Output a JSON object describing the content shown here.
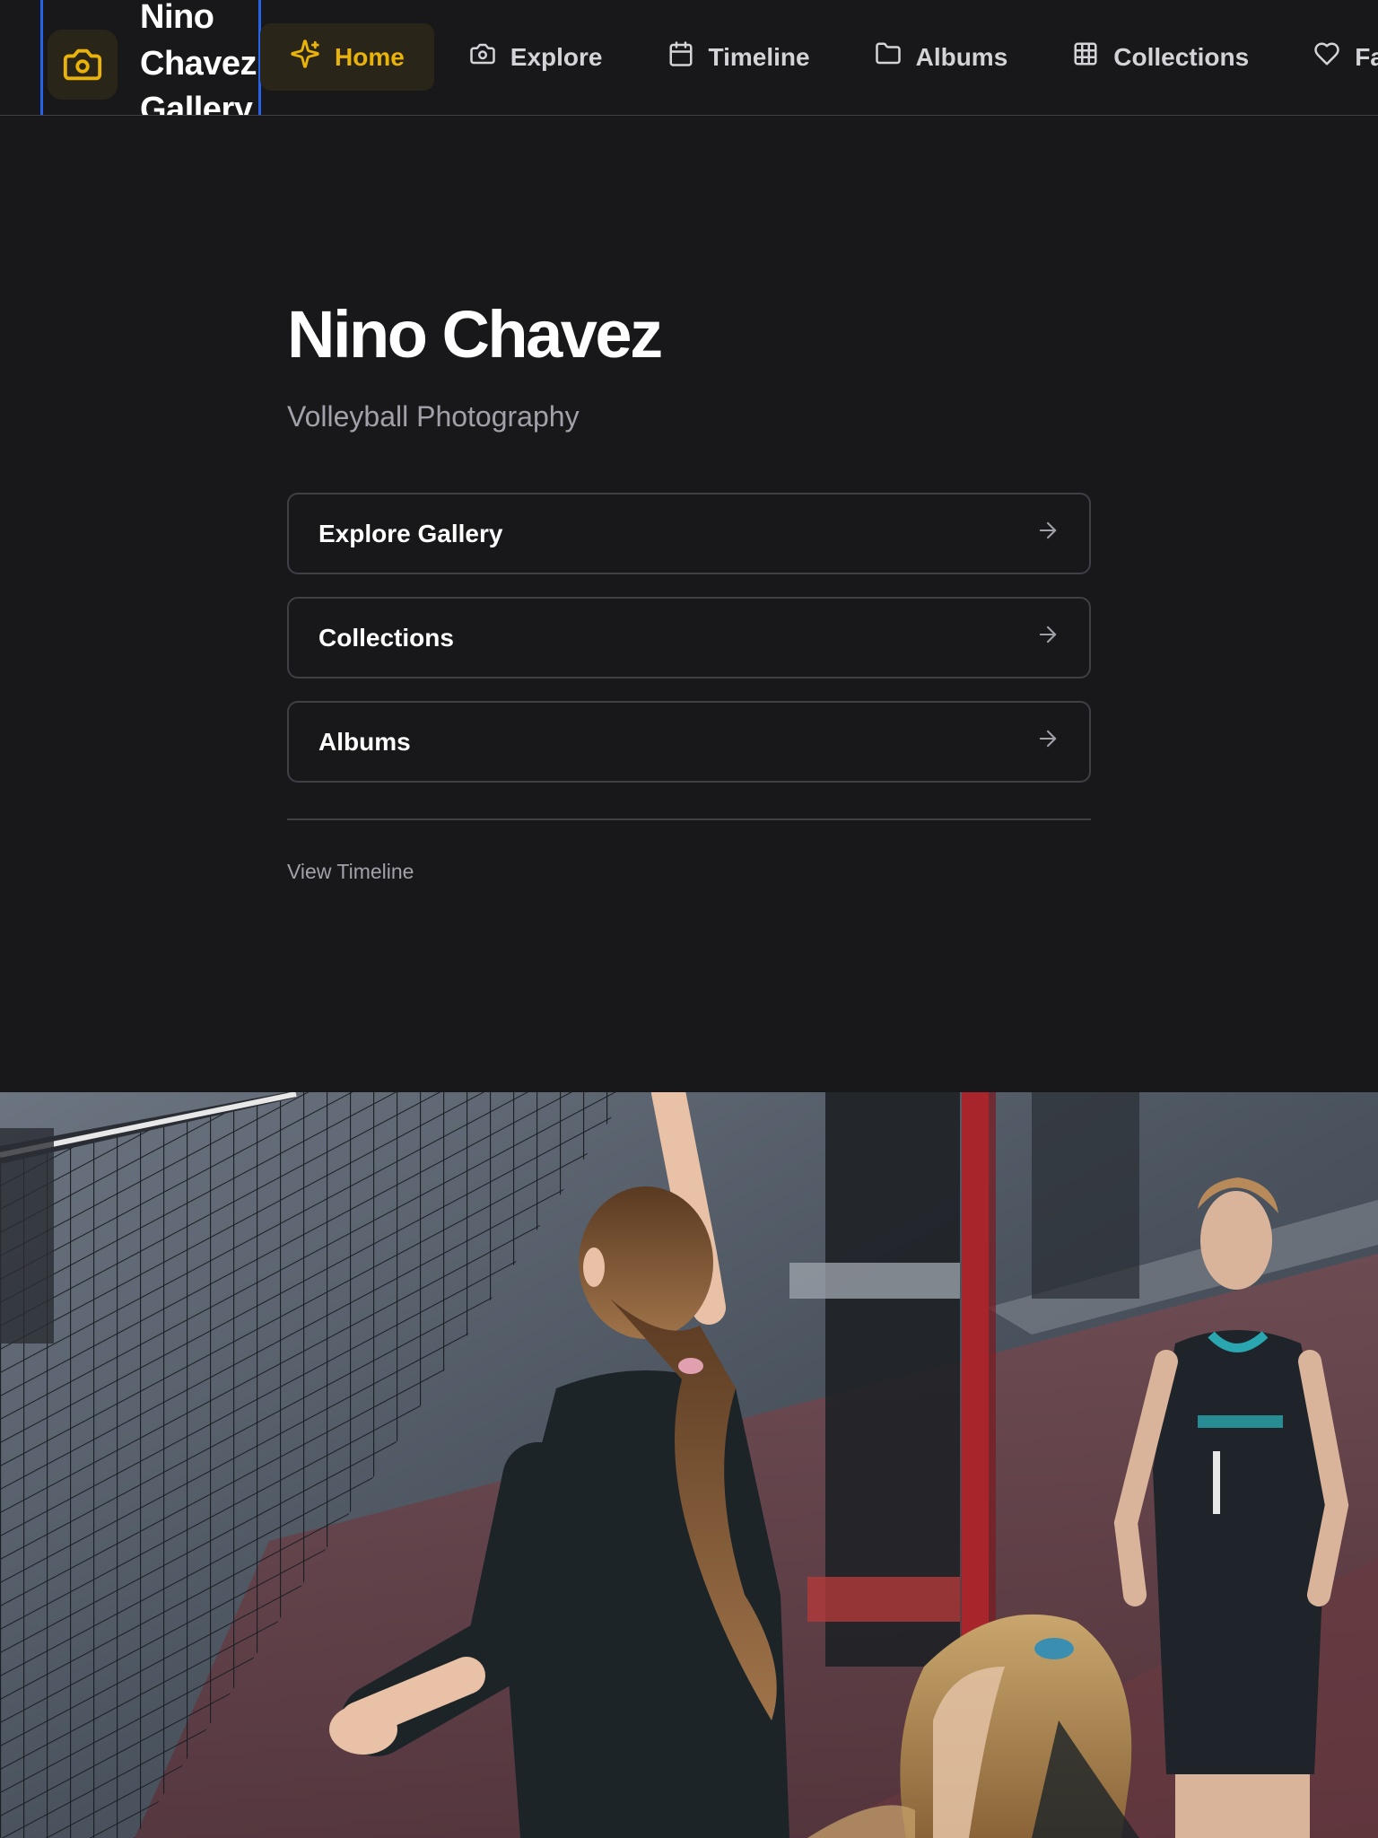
{
  "nav": {
    "brand": "Nino Chavez Gallery",
    "items": [
      {
        "label": "Home",
        "icon": "sparkles-icon",
        "active": true
      },
      {
        "label": "Explore",
        "icon": "camera-icon",
        "active": false
      },
      {
        "label": "Timeline",
        "icon": "calendar-icon",
        "active": false
      },
      {
        "label": "Albums",
        "icon": "folder-icon",
        "active": false
      },
      {
        "label": "Collections",
        "icon": "grid-icon",
        "active": false
      },
      {
        "label": "Fa",
        "icon": "heart-icon",
        "active": false
      }
    ],
    "accent_color": "#eab308"
  },
  "hero": {
    "title": "Nino Chavez",
    "subtitle": "Volleyball Photography",
    "links": [
      {
        "label": "Explore Gallery",
        "icon": "arrow-right-icon"
      },
      {
        "label": "Collections",
        "icon": "arrow-right-icon"
      },
      {
        "label": "Albums",
        "icon": "arrow-right-icon"
      }
    ],
    "secondary_link": "View Timeline"
  },
  "photo": {
    "subject": "volleyball players at the net"
  }
}
